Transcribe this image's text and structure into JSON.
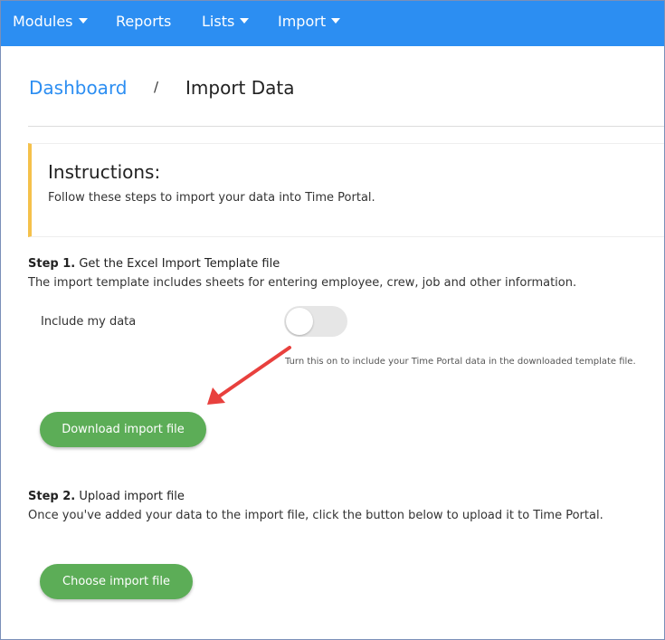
{
  "navbar": {
    "items": [
      {
        "label": "Modules",
        "has_dropdown": true
      },
      {
        "label": "Reports",
        "has_dropdown": false
      },
      {
        "label": "Lists",
        "has_dropdown": true
      },
      {
        "label": "Import",
        "has_dropdown": true
      }
    ],
    "background_color": "#2c8ef2"
  },
  "breadcrumb": {
    "parent": "Dashboard",
    "separator": "/",
    "current": "Import Data"
  },
  "instructions": {
    "title": "Instructions:",
    "text": "Follow these steps to import your data into Time Portal.",
    "accent_color": "#f5c14b"
  },
  "step1": {
    "label": "Step 1.",
    "title": "Get the Excel Import Template file",
    "description": "The import template includes sheets for entering employee, crew, job and other information.",
    "toggle_label": "Include my data",
    "toggle_on": false,
    "toggle_help": "Turn this on to include your Time Portal data in the downloaded template file.",
    "button_label": "Download import file"
  },
  "step2": {
    "label": "Step 2.",
    "title": "Upload import file",
    "description": "Once you've added your data to the import file, click the button below to upload it to Time Portal.",
    "button_label": "Choose import file"
  },
  "colors": {
    "button": "#5cad57",
    "link": "#2c8ef2",
    "annotation_arrow": "#e8403d"
  }
}
